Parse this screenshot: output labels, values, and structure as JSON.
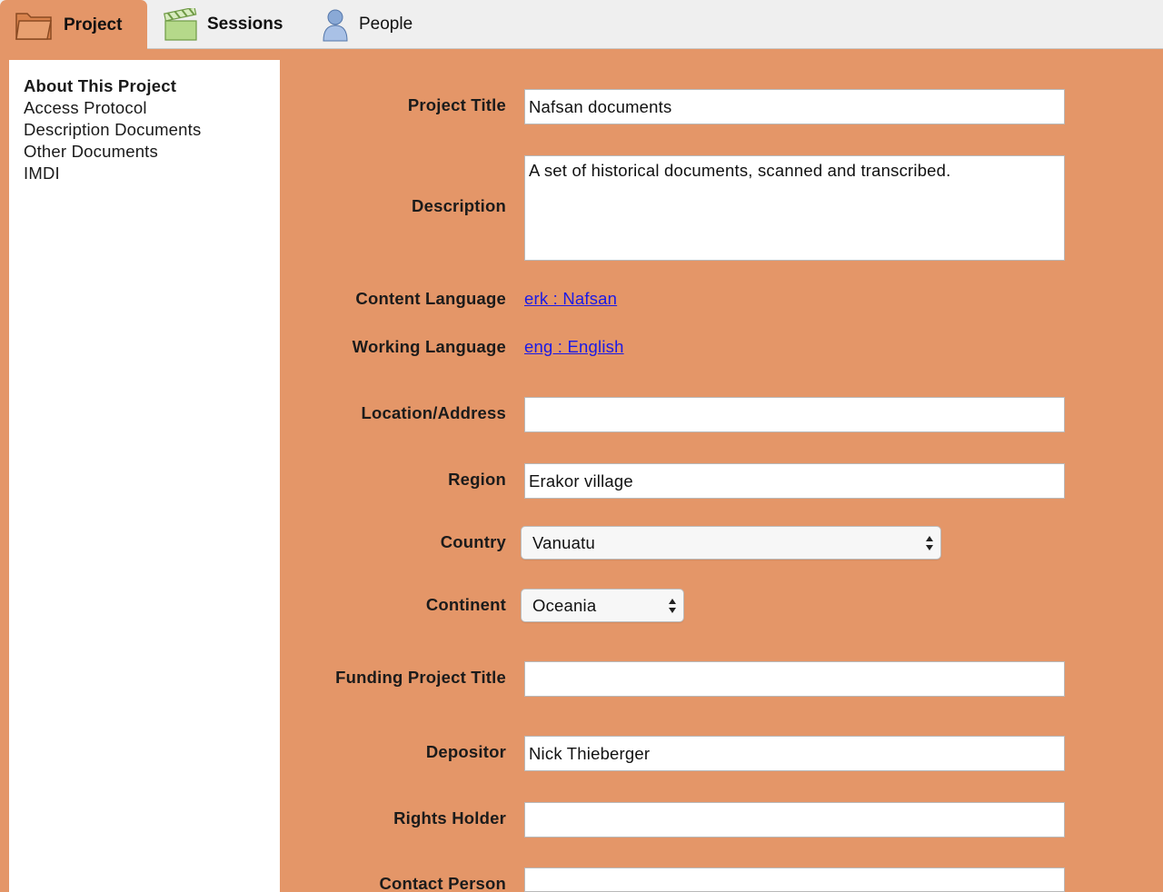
{
  "tabs": [
    {
      "label": "Project",
      "icon": "folder-icon"
    },
    {
      "label": "Sessions",
      "icon": "clapperboard-icon"
    },
    {
      "label": "People",
      "icon": "person-icon"
    }
  ],
  "sidebar": {
    "items": [
      {
        "label": "About This Project",
        "active": true
      },
      {
        "label": "Access Protocol"
      },
      {
        "label": "Description Documents"
      },
      {
        "label": "Other Documents"
      },
      {
        "label": "IMDI"
      }
    ]
  },
  "form": {
    "project_title": {
      "label": "Project Title",
      "value": "Nafsan documents"
    },
    "description": {
      "label": "Description",
      "value": "A set of historical documents, scanned and transcribed."
    },
    "content_language": {
      "label": "Content Language",
      "value": "erk : Nafsan"
    },
    "working_language": {
      "label": "Working Language",
      "value": "eng : English"
    },
    "location": {
      "label": "Location/Address",
      "value": ""
    },
    "region": {
      "label": "Region",
      "value": "Erakor village"
    },
    "country": {
      "label": "Country",
      "value": "Vanuatu"
    },
    "continent": {
      "label": "Continent",
      "value": "Oceania"
    },
    "funding_project_title": {
      "label": "Funding Project Title",
      "value": ""
    },
    "depositor": {
      "label": "Depositor",
      "value": "Nick Thieberger"
    },
    "rights_holder": {
      "label": "Rights Holder",
      "value": ""
    },
    "contact_person": {
      "label": "Contact Person",
      "value": ""
    }
  },
  "colors": {
    "background": "#e49668",
    "tabbar": "#efefef",
    "link": "#1a1ae6"
  }
}
